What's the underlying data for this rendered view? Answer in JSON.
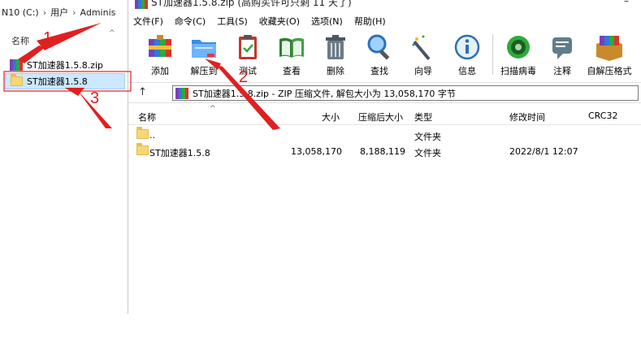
{
  "explorer": {
    "breadcrumb": [
      "N10 (C:)",
      "用户",
      "Adminis"
    ],
    "column_name": "名称",
    "items": [
      {
        "label": "ST加速器1.5.8.zip",
        "type": "archive"
      },
      {
        "label": "ST加速器1.5.8",
        "type": "folder",
        "selected": true
      }
    ]
  },
  "annotations": {
    "n1": "1",
    "n2": "2",
    "n3": "3",
    "color": "#e02020"
  },
  "rar": {
    "title": "ST加速器1.5.8.zip (高购买许可只剩 11 天了)",
    "window_minimize": "–",
    "menu": [
      "文件(F)",
      "命令(C)",
      "工具(S)",
      "收藏夹(O)",
      "选项(N)",
      "帮助(H)"
    ],
    "toolbar": {
      "add": "添加",
      "extract": "解压到",
      "test": "测试",
      "view": "查看",
      "delete": "删除",
      "find": "查找",
      "wizard": "向导",
      "info": "信息",
      "scan": "扫描病毒",
      "comment": "注释",
      "sfx": "自解压格式"
    },
    "address": "ST加速器1.5.8.zip - ZIP 压缩文件, 解包大小为 13,058,170 字节",
    "up_arrow": "↑",
    "columns": {
      "name": "名称",
      "size": "大小",
      "packed": "压缩后大小",
      "type": "类型",
      "modified": "修改时间",
      "crc": "CRC32"
    },
    "rows": [
      {
        "name": "..",
        "size": "",
        "packed": "",
        "type": "文件夹",
        "modified": ""
      },
      {
        "name": "ST加速器1.5.8",
        "size": "13,058,170",
        "packed": "8,188,119",
        "type": "文件夹",
        "modified": "2022/8/1 12:07"
      }
    ]
  }
}
